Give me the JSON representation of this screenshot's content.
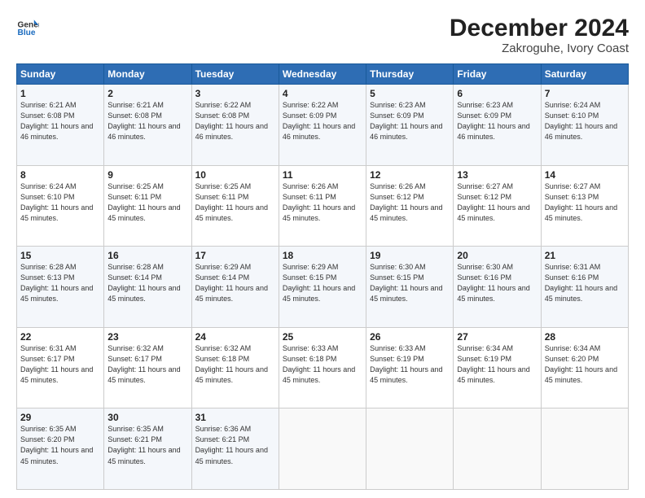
{
  "header": {
    "logo_line1": "General",
    "logo_line2": "Blue",
    "month": "December 2024",
    "location": "Zakroguhe, Ivory Coast"
  },
  "weekdays": [
    "Sunday",
    "Monday",
    "Tuesday",
    "Wednesday",
    "Thursday",
    "Friday",
    "Saturday"
  ],
  "weeks": [
    [
      {
        "day": "1",
        "sunrise": "6:21 AM",
        "sunset": "6:08 PM",
        "daylight": "11 hours and 46 minutes."
      },
      {
        "day": "2",
        "sunrise": "6:21 AM",
        "sunset": "6:08 PM",
        "daylight": "11 hours and 46 minutes."
      },
      {
        "day": "3",
        "sunrise": "6:22 AM",
        "sunset": "6:08 PM",
        "daylight": "11 hours and 46 minutes."
      },
      {
        "day": "4",
        "sunrise": "6:22 AM",
        "sunset": "6:09 PM",
        "daylight": "11 hours and 46 minutes."
      },
      {
        "day": "5",
        "sunrise": "6:23 AM",
        "sunset": "6:09 PM",
        "daylight": "11 hours and 46 minutes."
      },
      {
        "day": "6",
        "sunrise": "6:23 AM",
        "sunset": "6:09 PM",
        "daylight": "11 hours and 46 minutes."
      },
      {
        "day": "7",
        "sunrise": "6:24 AM",
        "sunset": "6:10 PM",
        "daylight": "11 hours and 46 minutes."
      }
    ],
    [
      {
        "day": "8",
        "sunrise": "6:24 AM",
        "sunset": "6:10 PM",
        "daylight": "11 hours and 45 minutes."
      },
      {
        "day": "9",
        "sunrise": "6:25 AM",
        "sunset": "6:11 PM",
        "daylight": "11 hours and 45 minutes."
      },
      {
        "day": "10",
        "sunrise": "6:25 AM",
        "sunset": "6:11 PM",
        "daylight": "11 hours and 45 minutes."
      },
      {
        "day": "11",
        "sunrise": "6:26 AM",
        "sunset": "6:11 PM",
        "daylight": "11 hours and 45 minutes."
      },
      {
        "day": "12",
        "sunrise": "6:26 AM",
        "sunset": "6:12 PM",
        "daylight": "11 hours and 45 minutes."
      },
      {
        "day": "13",
        "sunrise": "6:27 AM",
        "sunset": "6:12 PM",
        "daylight": "11 hours and 45 minutes."
      },
      {
        "day": "14",
        "sunrise": "6:27 AM",
        "sunset": "6:13 PM",
        "daylight": "11 hours and 45 minutes."
      }
    ],
    [
      {
        "day": "15",
        "sunrise": "6:28 AM",
        "sunset": "6:13 PM",
        "daylight": "11 hours and 45 minutes."
      },
      {
        "day": "16",
        "sunrise": "6:28 AM",
        "sunset": "6:14 PM",
        "daylight": "11 hours and 45 minutes."
      },
      {
        "day": "17",
        "sunrise": "6:29 AM",
        "sunset": "6:14 PM",
        "daylight": "11 hours and 45 minutes."
      },
      {
        "day": "18",
        "sunrise": "6:29 AM",
        "sunset": "6:15 PM",
        "daylight": "11 hours and 45 minutes."
      },
      {
        "day": "19",
        "sunrise": "6:30 AM",
        "sunset": "6:15 PM",
        "daylight": "11 hours and 45 minutes."
      },
      {
        "day": "20",
        "sunrise": "6:30 AM",
        "sunset": "6:16 PM",
        "daylight": "11 hours and 45 minutes."
      },
      {
        "day": "21",
        "sunrise": "6:31 AM",
        "sunset": "6:16 PM",
        "daylight": "11 hours and 45 minutes."
      }
    ],
    [
      {
        "day": "22",
        "sunrise": "6:31 AM",
        "sunset": "6:17 PM",
        "daylight": "11 hours and 45 minutes."
      },
      {
        "day": "23",
        "sunrise": "6:32 AM",
        "sunset": "6:17 PM",
        "daylight": "11 hours and 45 minutes."
      },
      {
        "day": "24",
        "sunrise": "6:32 AM",
        "sunset": "6:18 PM",
        "daylight": "11 hours and 45 minutes."
      },
      {
        "day": "25",
        "sunrise": "6:33 AM",
        "sunset": "6:18 PM",
        "daylight": "11 hours and 45 minutes."
      },
      {
        "day": "26",
        "sunrise": "6:33 AM",
        "sunset": "6:19 PM",
        "daylight": "11 hours and 45 minutes."
      },
      {
        "day": "27",
        "sunrise": "6:34 AM",
        "sunset": "6:19 PM",
        "daylight": "11 hours and 45 minutes."
      },
      {
        "day": "28",
        "sunrise": "6:34 AM",
        "sunset": "6:20 PM",
        "daylight": "11 hours and 45 minutes."
      }
    ],
    [
      {
        "day": "29",
        "sunrise": "6:35 AM",
        "sunset": "6:20 PM",
        "daylight": "11 hours and 45 minutes."
      },
      {
        "day": "30",
        "sunrise": "6:35 AM",
        "sunset": "6:21 PM",
        "daylight": "11 hours and 45 minutes."
      },
      {
        "day": "31",
        "sunrise": "6:36 AM",
        "sunset": "6:21 PM",
        "daylight": "11 hours and 45 minutes."
      },
      null,
      null,
      null,
      null
    ]
  ]
}
